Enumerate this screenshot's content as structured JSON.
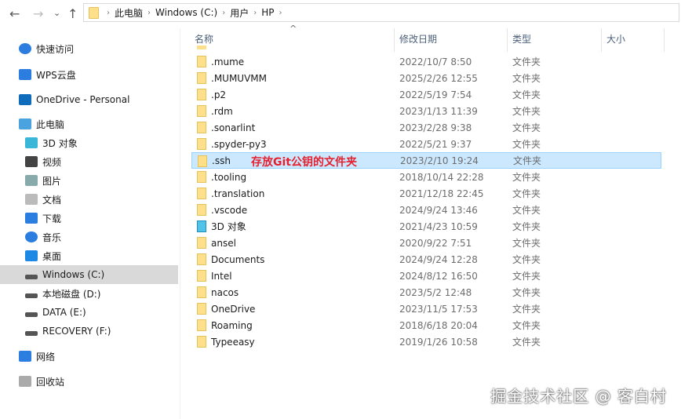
{
  "nav": {
    "back": "←",
    "forward": "→",
    "recent": "⌄",
    "up": "↑"
  },
  "address": [
    "此电脑",
    "Windows (C:)",
    "用户",
    "HP"
  ],
  "sidebar": [
    {
      "label": "快速访问",
      "icon": "star-icon",
      "color": "#2b7de0"
    },
    {
      "label": "WPS云盘",
      "icon": "cloud-icon",
      "color": "#2b7de0"
    },
    {
      "label": "OneDrive - Personal",
      "icon": "onedrive-icon",
      "color": "#0f6cbd"
    },
    {
      "label": "此电脑",
      "icon": "computer-icon",
      "color": "#4aa3df"
    },
    {
      "label": "3D 对象",
      "icon": "cube-icon",
      "color": "#3ab7d8"
    },
    {
      "label": "视频",
      "icon": "film-icon",
      "color": "#444"
    },
    {
      "label": "图片",
      "icon": "picture-icon",
      "color": "#8aa"
    },
    {
      "label": "文档",
      "icon": "document-icon",
      "color": "#bbb"
    },
    {
      "label": "下载",
      "icon": "download-icon",
      "color": "#2b7de0"
    },
    {
      "label": "音乐",
      "icon": "music-icon",
      "color": "#2b7de0"
    },
    {
      "label": "桌面",
      "icon": "desktop-icon",
      "color": "#1e88e5"
    },
    {
      "label": "Windows (C:)",
      "icon": "drive-icon",
      "color": "#555"
    },
    {
      "label": "本地磁盘 (D:)",
      "icon": "drive-icon",
      "color": "#555"
    },
    {
      "label": "DATA (E:)",
      "icon": "drive-icon",
      "color": "#555"
    },
    {
      "label": "RECOVERY (F:)",
      "icon": "drive-icon",
      "color": "#555"
    },
    {
      "label": "网络",
      "icon": "network-icon",
      "color": "#2b7de0"
    },
    {
      "label": "回收站",
      "icon": "recycle-bin-icon",
      "color": "#aaa"
    }
  ],
  "columns": {
    "name": "名称",
    "date": "修改日期",
    "type": "类型",
    "size": "大小"
  },
  "files": [
    {
      "name": ".mume",
      "date": "2022/10/7 8:50",
      "type": "文件夹"
    },
    {
      "name": ".MUMUVMM",
      "date": "2025/2/26 12:55",
      "type": "文件夹"
    },
    {
      "name": ".p2",
      "date": "2022/5/19 7:54",
      "type": "文件夹"
    },
    {
      "name": ".rdm",
      "date": "2023/1/13 11:39",
      "type": "文件夹"
    },
    {
      "name": ".sonarlint",
      "date": "2023/2/28 9:38",
      "type": "文件夹"
    },
    {
      "name": ".spyder-py3",
      "date": "2022/5/21 9:37",
      "type": "文件夹"
    },
    {
      "name": ".ssh",
      "date": "2023/2/10 19:24",
      "type": "文件夹",
      "selected": true
    },
    {
      "name": ".tooling",
      "date": "2018/10/14 22:28",
      "type": "文件夹"
    },
    {
      "name": ".translation",
      "date": "2021/12/18 22:45",
      "type": "文件夹"
    },
    {
      "name": ".vscode",
      "date": "2024/9/24 13:46",
      "type": "文件夹"
    },
    {
      "name": "3D 对象",
      "date": "2021/4/23 10:59",
      "type": "文件夹",
      "cube": true
    },
    {
      "name": "ansel",
      "date": "2020/9/22 7:51",
      "type": "文件夹"
    },
    {
      "name": "Documents",
      "date": "2024/9/24 12:28",
      "type": "文件夹"
    },
    {
      "name": "Intel",
      "date": "2024/8/12 16:50",
      "type": "文件夹"
    },
    {
      "name": "nacos",
      "date": "2023/5/2 12:48",
      "type": "文件夹"
    },
    {
      "name": "OneDrive",
      "date": "2023/11/5 17:53",
      "type": "文件夹"
    },
    {
      "name": "Roaming",
      "date": "2018/6/18 20:04",
      "type": "文件夹"
    },
    {
      "name": "Typeeasy",
      "date": "2019/1/26 10:58",
      "type": "文件夹"
    }
  ],
  "annotation": "存放Git公钥的文件夹",
  "watermark": "掘金技术社区 @ 客白村"
}
